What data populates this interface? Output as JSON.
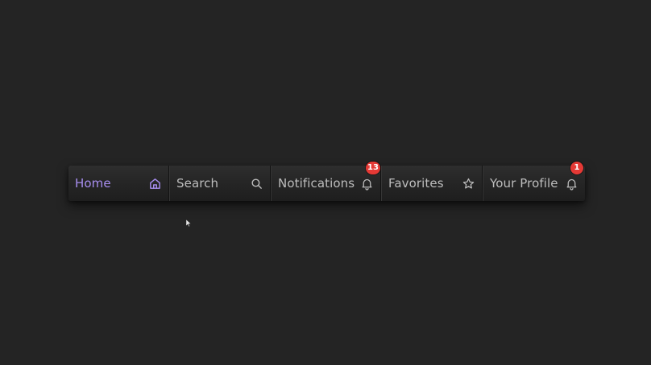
{
  "colors": {
    "background": "#242424",
    "bar": "#262626",
    "text": "#bdbdbd",
    "accent": "#a88ef0",
    "badge": "#e53935"
  },
  "nav": {
    "items": [
      {
        "label": "Home",
        "icon": "home-icon",
        "active": true
      },
      {
        "label": "Search",
        "icon": "search-icon",
        "active": false
      },
      {
        "label": "Notifications",
        "icon": "bell-icon",
        "active": false,
        "badge": "13"
      },
      {
        "label": "Favorites",
        "icon": "star-icon",
        "active": false
      },
      {
        "label": "Your Profile",
        "icon": "bell-icon",
        "active": false,
        "badge": "1"
      }
    ]
  }
}
